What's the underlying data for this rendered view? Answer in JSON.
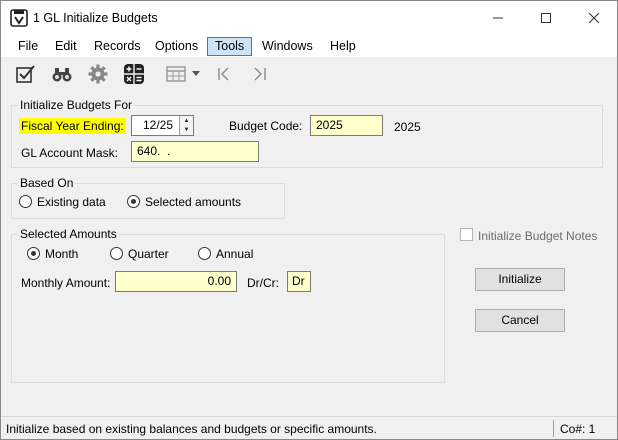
{
  "window": {
    "title": "1 GL Initialize Budgets"
  },
  "menu": {
    "items": [
      "File",
      "Edit",
      "Records",
      "Options",
      "Tools",
      "Windows",
      "Help"
    ],
    "active": "Tools"
  },
  "toolbar": {
    "icons": [
      "checklist-icon",
      "binoculars-icon",
      "gear-icon",
      "calculator-icon",
      "grid-icon",
      "dropdown-arrow-icon",
      "first-record-icon",
      "last-record-icon"
    ]
  },
  "init_group": {
    "legend": "Initialize Budgets For",
    "fiscal_year_label": "Fiscal Year Ending:",
    "fiscal_year_value": "12/25",
    "budget_code_label": "Budget Code:",
    "budget_code_value": "2025",
    "budget_code_display": "2025",
    "account_mask_label": "GL Account Mask:",
    "account_mask_value": "640.  ."
  },
  "based_on": {
    "legend": "Based On",
    "options": [
      "Existing data",
      "Selected amounts"
    ],
    "selected": "Selected amounts"
  },
  "selected_amounts": {
    "legend": "Selected Amounts",
    "periods": [
      "Month",
      "Quarter",
      "Annual"
    ],
    "selected_period": "Month",
    "amount_label": "Monthly Amount:",
    "amount_value": "0.00",
    "drcr_label": "Dr/Cr:",
    "drcr_value": "Dr"
  },
  "notes": {
    "label": "Initialize Budget Notes",
    "checked": false,
    "enabled": false
  },
  "buttons": {
    "initialize": "Initialize",
    "cancel": "Cancel"
  },
  "status": {
    "message": "Initialize based on existing balances and budgets or specific amounts.",
    "company": "Co#: 1"
  },
  "colors": {
    "field_bg": "#ffffcc",
    "highlight": "#ffff00",
    "menu_active": "#cce4f7"
  }
}
